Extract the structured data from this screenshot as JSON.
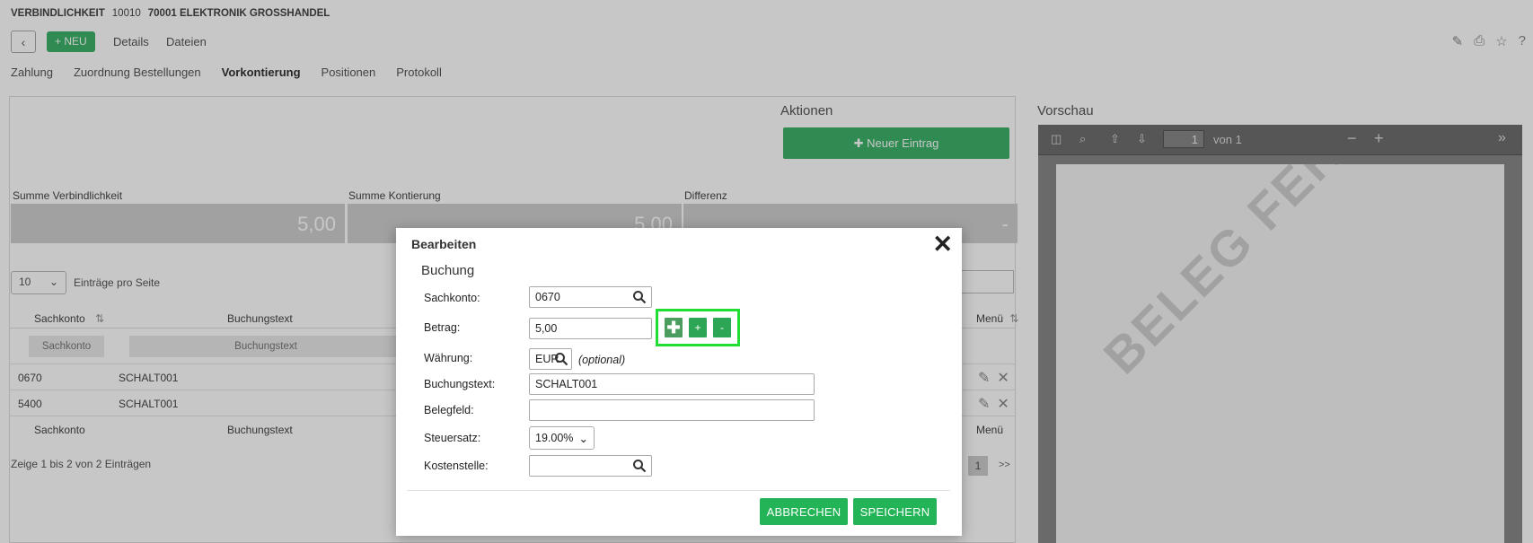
{
  "header": {
    "title": "VERBINDLICHKEIT",
    "number": "10010",
    "vendor": "70001 ELEKTRONIK GROSSHANDEL",
    "new_button": "+ NEU",
    "links": [
      "Details",
      "Dateien"
    ]
  },
  "tabs": [
    "Zahlung",
    "Zuordnung Bestellungen",
    "Vorkontierung",
    "Positionen",
    "Protokoll"
  ],
  "active_tab": "Vorkontierung",
  "aktionen": {
    "title": "Aktionen",
    "new_entry": "✚ Neuer Eintrag"
  },
  "summary": {
    "labels": [
      "Summe Verbindlichkeit",
      "Summe Kontierung",
      "Differenz"
    ],
    "values": [
      "5,00",
      "5,00",
      "-"
    ]
  },
  "table": {
    "per_page_value": "10",
    "per_page_label": "Einträge pro Seite",
    "columns": {
      "sachkonto": "Sachkonto",
      "buchungstext": "Buchungstext",
      "menu": "Menü"
    },
    "filters": {
      "sachkonto": "Sachkonto",
      "buchungstext": "Buchungstext"
    },
    "rows": [
      {
        "sachkonto": "0670",
        "buchungstext": "SCHALT001"
      },
      {
        "sachkonto": "5400",
        "buchungstext": "SCHALT001"
      }
    ],
    "pager_info": "Zeige 1 bis 2 von 2 Einträgen",
    "current_page": "1",
    "next": ">>"
  },
  "preview": {
    "title": "Vorschau",
    "page_input": "1",
    "page_of": "von 1",
    "watermark": "BELEG FEHLT"
  },
  "modal": {
    "title": "Bearbeiten",
    "subtitle": "Buchung",
    "labels": {
      "sachkonto": "Sachkonto:",
      "betrag": "Betrag:",
      "waehrung": "Währung:",
      "buchungstext": "Buchungstext:",
      "belegfeld": "Belegfeld:",
      "steuersatz": "Steuersatz:",
      "kostenstelle": "Kostenstelle:"
    },
    "values": {
      "sachkonto": "0670",
      "betrag": "5,00",
      "waehrung": "EUR",
      "buchungstext": "SCHALT001",
      "belegfeld": "",
      "steuersatz": "19.00%",
      "kostenstelle": ""
    },
    "optional": "(optional)",
    "group_buttons": [
      "✚",
      "+",
      "-"
    ],
    "cancel": "ABBRECHEN",
    "save": "SPEICHERN"
  },
  "colors": {
    "primary_green": "#22b456",
    "highlight_green": "#22dd33"
  }
}
